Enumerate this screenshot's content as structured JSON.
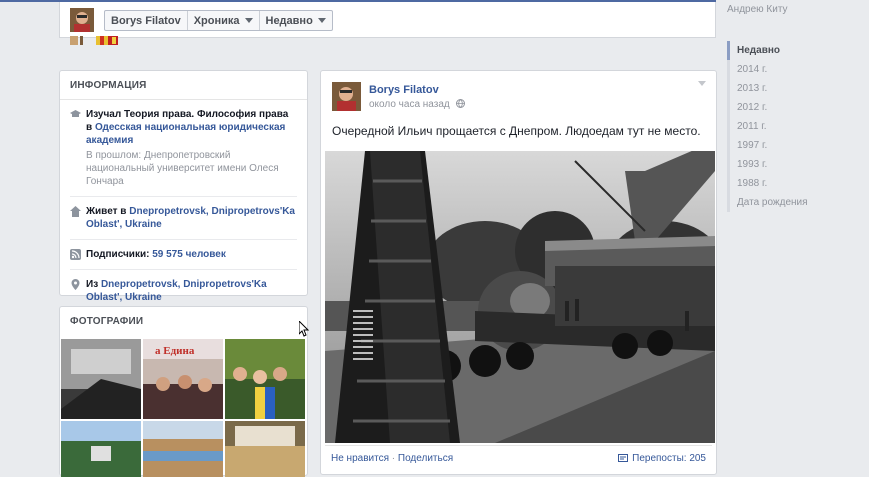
{
  "header": {
    "name": "Borys Filatov",
    "tab_timeline": "Хроника",
    "tab_recent": "Недавно"
  },
  "years_rail": {
    "friend_text": "Андрею Киту",
    "items": [
      "Недавно",
      "2014 г.",
      "2013 г.",
      "2012 г.",
      "2011 г.",
      "1997 г.",
      "1993 г.",
      "1988 г.",
      "Дата рождения"
    ]
  },
  "info": {
    "title": "ИНФОРМАЦИЯ",
    "study_prefix": "Изучал Теория права. Философия права в",
    "study_school": "Одесская национальная юридическая академия",
    "past_text": "В прошлом: Днепропетровский национальный университет имени Олеся Гончара",
    "lives_prefix": "Живет в",
    "lives_place": "Dnepropetrovsk, Dnipropetrovs'Ka Oblast', Ukraine",
    "followers_prefix": "Подписчики:",
    "followers_count": "59 575 человек",
    "from_prefix": "Из",
    "from_place": "Dnepropetrovsk, Dnipropetrovs'Ka Oblast', Ukraine"
  },
  "photos": {
    "title": "ФОТОГРАФИИ",
    "banner_text": "а Едина"
  },
  "post": {
    "author": "Borys Filatov",
    "time": "около часа назад",
    "text": "Очередной Ильич прощается с Днепром. Людоедам тут не место.",
    "like": "Не нравится",
    "separator": "·",
    "share": "Поделиться",
    "shares": "Перепосты: 205"
  }
}
